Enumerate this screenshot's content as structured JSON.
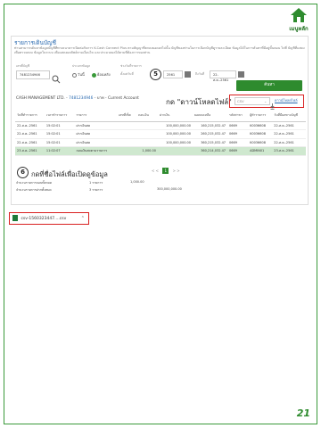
{
  "brand": {
    "name": "เมนูหลัก",
    "color": "#2e8b2e"
  },
  "screen": {
    "section_title": "รายการเดินบัญชี",
    "description": "ท่านสามารถค้นหาข้อมูลบัญชีที่ทางธนาคารเปิดต่อกับการ K-Cash Connect Plus ตามสัญญาที่ตกลงยอดยกไปนั้น บัญชีของท่านในการเลือกบัญชีดูรายละเอียด ข้อมูลได้ในการค้นหาที่มีอยู่ขั้นตอน ไปที่ บัญชีที่แสดง เพื่อตรวจสอบ ข้อมูลในระบบ เพื่อแสดงผลลัพธ์ตามเงื่อนไข และประมวลผลได้ตามที่ต้องการของท่าน",
    "account_label": "เลขที่บัญชี",
    "account_value": "7481234946",
    "inquiry_type_label": "ประเภทข้อมูล",
    "radio_today": "วันนี้",
    "radio_history": "ย้อนหลัง",
    "date_range_label": "ช่วงวันที่รายการ",
    "from_label": "ตั้งแต่วันที่",
    "from_value": "2561",
    "to_label": "ถึงวันที่",
    "to_value": "22-ส.ค.-2561",
    "find_button": "ค้นหา",
    "account_name": "CASH MANAGEMENT LTD.",
    "account_link": "7481234946",
    "account_type": "บาท - Current Account",
    "download_callout": "กด \"ดาวน์โหลดไฟล์\"",
    "format_value": "CSV",
    "download_link": "ดาวน์โหลดไฟล์",
    "columns": [
      "วันที่ทำรายการ",
      "เวลาทำรายการ",
      "รายการ",
      "เลขที่เช็ค",
      "ถอนเงิน",
      "ฝากเงิน",
      "ยอดคงเหลือ",
      "รหัสสาขา",
      "ผู้ทำรายการ",
      "วันที่มีผลทางบัญชี"
    ],
    "rows": [
      [
        "22-ส.ค.-2561",
        "15:02:01",
        "ฝากเงินสด",
        "",
        "",
        "100,000,000.00",
        "160,215,032.47",
        "0669",
        "K0036608",
        "22-ส.ค.-2561"
      ],
      [
        "22-ส.ค.-2561",
        "15:02:01",
        "ฝากเงินสด",
        "",
        "",
        "100,000,000.00",
        "260,215,032.47",
        "0669",
        "K0036608",
        "22-ส.ค.-2561"
      ],
      [
        "22-ส.ค.-2561",
        "15:02:01",
        "ฝากเงินสด",
        "",
        "",
        "100,000,000.00",
        "360,215,032.47",
        "0669",
        "K0036608",
        "22-ส.ค.-2561"
      ],
      [
        "23-ส.ค.-2561",
        "11:02:07",
        "ถอนเงินสดตามรายการ",
        "",
        "1,000.00",
        "",
        "360,214,032.47",
        "0669",
        "ADMIN01",
        "23-ส.ค.-2561"
      ]
    ],
    "pager": {
      "prev2": "<",
      "prev": "<",
      "current": "1",
      "next": ">",
      "next2": ">"
    },
    "callout_six": "กดที่ชื่อไฟล์เพื่อเปิดดูข้อมูล",
    "summary": [
      {
        "label": "จำนวนรายการถอนทั้งหมด",
        "count": "1 รายการ",
        "amount": "1,000.00"
      },
      {
        "label": "จำนวนรายการฝากทั้งหมด",
        "count": "3 รายการ",
        "amount": "300,000,000.00"
      }
    ],
    "downloaded_file": "csv-1560323447....csv"
  },
  "steps": {
    "five": "5",
    "six": "6"
  },
  "page_number": "21"
}
